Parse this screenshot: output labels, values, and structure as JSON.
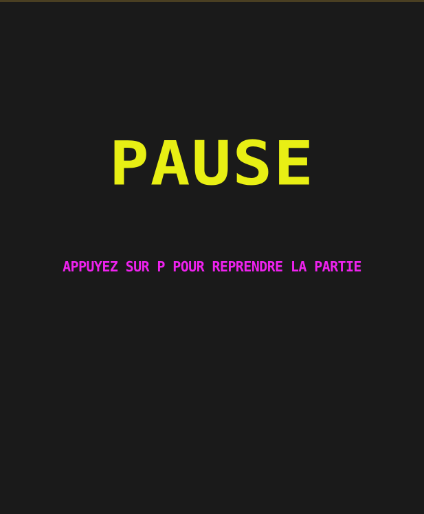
{
  "overlay": {
    "title": "PAUSE",
    "hint": "APPUYEZ SUR P POUR REPRENDRE LA PARTIE"
  },
  "colors": {
    "background": "#1a1a1a",
    "title": "#e8ef14",
    "hint": "#ee22ee",
    "top_border": "#4a3f22"
  }
}
